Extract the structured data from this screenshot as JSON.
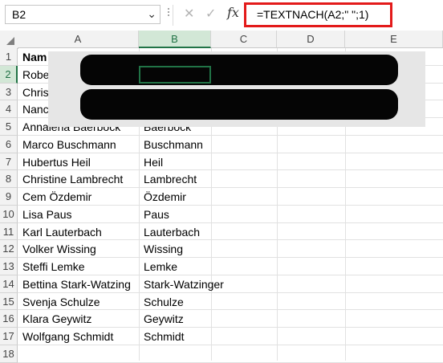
{
  "formula_bar": {
    "name_box": "B2",
    "cancel_glyph": "✕",
    "enter_glyph": "✓",
    "fx_label": "fx",
    "formula": "=TEXTNACH(A2;\" \";1)"
  },
  "columns": [
    "A",
    "B",
    "C",
    "D",
    "E"
  ],
  "rows": [
    {
      "n": "1",
      "a": "Nam",
      "b": ""
    },
    {
      "n": "2",
      "a": "Robe",
      "b": ""
    },
    {
      "n": "3",
      "a": "Chris",
      "b": ""
    },
    {
      "n": "4",
      "a": "Nanc",
      "b": ""
    },
    {
      "n": "5",
      "a": "Annalena Baerbock",
      "b": "Baerbock"
    },
    {
      "n": "6",
      "a": "Marco Buschmann",
      "b": "Buschmann"
    },
    {
      "n": "7",
      "a": "Hubertus Heil",
      "b": "Heil"
    },
    {
      "n": "8",
      "a": "Christine Lambrecht",
      "b": "Lambrecht"
    },
    {
      "n": "9",
      "a": "Cem Özdemir",
      "b": "Özdemir"
    },
    {
      "n": "10",
      "a": "Lisa Paus",
      "b": "Paus"
    },
    {
      "n": "11",
      "a": "Karl Lauterbach",
      "b": "Lauterbach"
    },
    {
      "n": "12",
      "a": "Volker Wissing",
      "b": "Wissing"
    },
    {
      "n": "13",
      "a": "Steffi Lemke",
      "b": "Lemke"
    },
    {
      "n": "14",
      "a": "Bettina Stark-Watzing",
      "b": "Stark-Watzinger"
    },
    {
      "n": "15",
      "a": "Svenja Schulze",
      "b": "Schulze"
    },
    {
      "n": "16",
      "a": "Klara Geywitz",
      "b": "Geywitz"
    },
    {
      "n": "17",
      "a": "Wolfgang Schmidt",
      "b": "Schmidt"
    },
    {
      "n": "18",
      "a": "",
      "b": ""
    }
  ],
  "colors": {
    "accent": "#217346",
    "highlight": "#e31a1a",
    "redaction": "#050505"
  }
}
